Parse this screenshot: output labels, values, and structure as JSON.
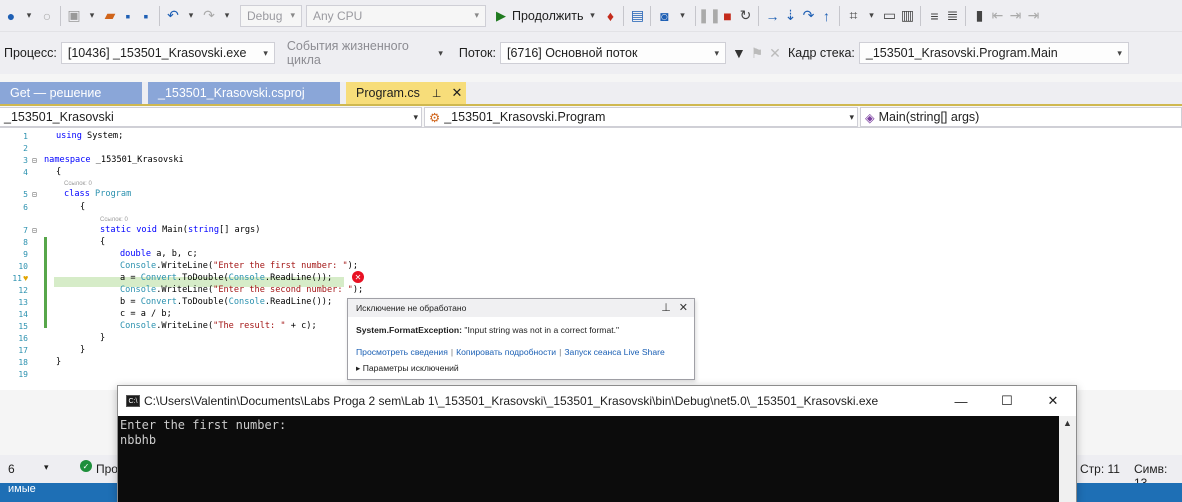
{
  "toolbar": {
    "config": "Debug",
    "platform": "Any CPU",
    "continue_label": "Продолжить"
  },
  "debug_bar": {
    "process_label": "Процесс:",
    "process_value": "[10436] _153501_Krasovski.exe",
    "lifecycle_label": "События жизненного цикла",
    "thread_label": "Поток:",
    "thread_value": "[6716] Основной поток",
    "stack_label": "Кадр стека:",
    "stack_value": "_153501_Krasovski.Program.Main"
  },
  "tabs": [
    {
      "label": "Get — решение"
    },
    {
      "label": "_153501_Krasovski.csproj"
    },
    {
      "label": "Program.cs"
    }
  ],
  "navbar": {
    "project": "_153501_Krasovski",
    "class": "_153501_Krasovski.Program",
    "member": "Main(string[] args)"
  },
  "code": {
    "line_numbers": [
      "1",
      "2",
      "3",
      "4",
      "5",
      "6",
      "7",
      "8",
      "9",
      "10",
      "11",
      "12",
      "13",
      "14",
      "15",
      "16",
      "17",
      "18",
      "19"
    ],
    "refs": "Ссылок: 0",
    "l1_kw": "using",
    "l1_rest": " System;",
    "l3_kw": "namespace",
    "l3_rest": " _153501_Krasovski",
    "l4": "{",
    "l5_kw": "class",
    "l5_cls": " Program",
    "l6": "{",
    "l7_kw1": "static",
    "l7_kw2": " void",
    "l7_rest": " Main(",
    "l7_kw3": "string",
    "l7_end": "[] args)",
    "l8": "{",
    "l9_kw": "double",
    "l9_rest": " a, b, c;",
    "l10_cls": "Console",
    "l10_mid": ".WriteLine(",
    "l10_str": "\"Enter the first number: \"",
    "l10_end": ");",
    "l11_pre": "a = ",
    "l11_cls1": "Convert",
    "l11_mid": ".ToDouble(",
    "l11_cls2": "Console",
    "l11_end": ".ReadLine());",
    "l12_cls": "Console",
    "l12_mid": ".WriteLine(",
    "l12_str": "\"Enter the second number: \"",
    "l12_end": ");",
    "l13_pre": "b = ",
    "l13_cls1": "Convert",
    "l13_mid": ".ToDouble(",
    "l13_cls2": "Console",
    "l13_end": ".ReadLine());",
    "l14": "c = a / b;",
    "l15_cls": "Console",
    "l15_mid": ".WriteLine(",
    "l15_str": "\"The result: \"",
    "l15_end": " + c);",
    "l16": "}",
    "l17": "}",
    "l18": "}"
  },
  "exception": {
    "header": "Исключение не обработано",
    "type": "System.FormatException:",
    "message": "\"Input string was not in a correct format.\"",
    "link1": "Просмотреть сведения",
    "link2": "Копировать подробности",
    "link3": "Запуск сеанса Live Share",
    "params": "▸ Параметры исключений"
  },
  "console": {
    "title": "C:\\Users\\Valentin\\Documents\\Labs Proga 2 sem\\Lab 1\\_153501_Krasovski\\_153501_Krasovski\\bin\\Debug\\net5.0\\_153501_Krasovski.exe",
    "output": "Enter the first number:\nnbbhb"
  },
  "statusbar": {
    "zoom": "6",
    "issues": "Про",
    "line": "Стр: 11",
    "col": "Симв: 13"
  },
  "bottom": {
    "label": "имые"
  },
  "colors": {
    "tab_active": "#f7dd7a",
    "tab_inactive": "#8aa6d8",
    "console_bg": "#0c0c0c",
    "error_red": "#e81123"
  }
}
